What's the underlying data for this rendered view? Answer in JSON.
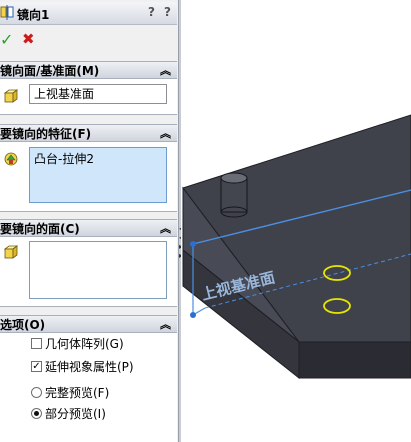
{
  "title": {
    "text": "镜向1",
    "help": "?",
    "help_detail": "?"
  },
  "actions": {
    "ok": "✓",
    "cancel": "✖"
  },
  "mirror_face": {
    "header": "镜向面/基准面(M)",
    "value": "上视基准面"
  },
  "features_to_mirror": {
    "header": "要镜向的特征(F)",
    "items": [
      "凸台-拉伸2"
    ]
  },
  "faces_to_mirror": {
    "header": "要镜向的面(C)"
  },
  "options": {
    "header": "选项(O)",
    "geometry_pattern": {
      "label": "几何体阵列(G)",
      "checked": false
    },
    "propagate_visual": {
      "label": "延伸视象属性(P)",
      "checked": true
    },
    "full_preview": {
      "label": "完整预览(F)",
      "selected": false
    },
    "partial_preview": {
      "label": "部分预览(I)",
      "selected": true
    }
  },
  "viewport": {
    "plane_label": "上视基准面",
    "colors": {
      "body": "#3a3c45",
      "plane": "#4a90e2",
      "highlight": "#e8e600"
    }
  }
}
